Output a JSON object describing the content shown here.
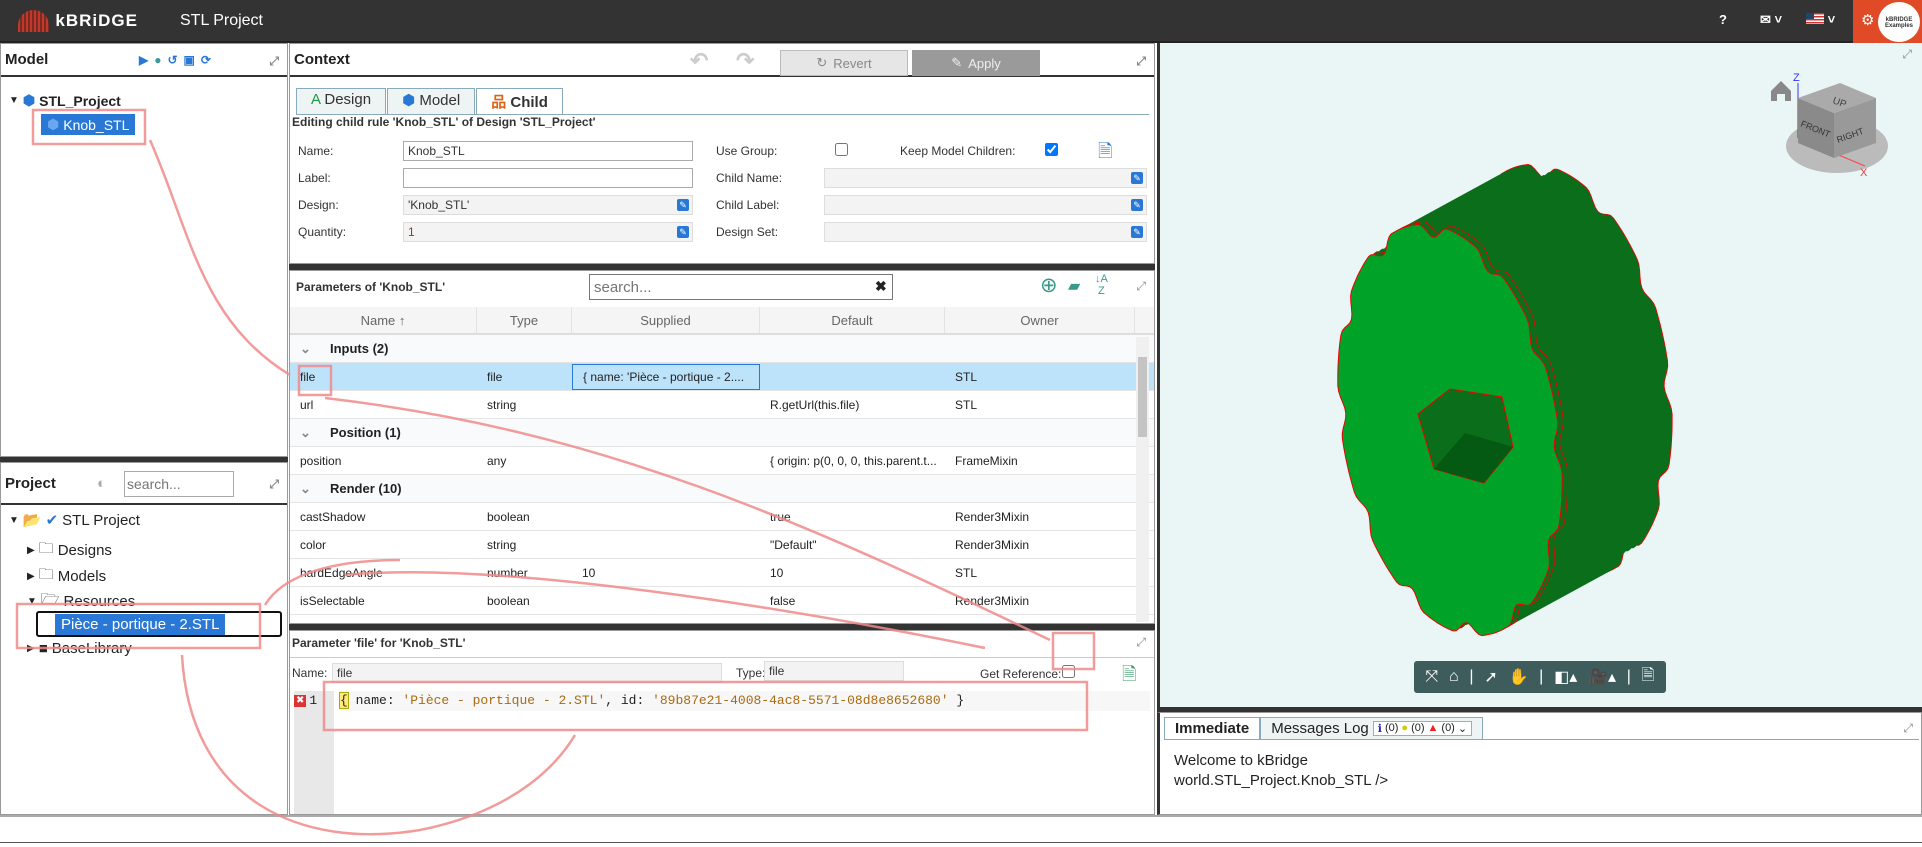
{
  "app": {
    "brand": "kBRiDGE",
    "title": "STL Project",
    "help": "?",
    "examples_logo": "kBRIDGE Examples"
  },
  "colors": {
    "accent": "#2a78d6",
    "topbar": "#333333",
    "settings": "#e04a26",
    "annotation": "#f08a8a",
    "gear_face": "#00a328",
    "gear_side": "#006a12",
    "viewer_bg": "#eaf6f6"
  },
  "model": {
    "title": "Model",
    "tree": [
      {
        "label": "STL_Project"
      },
      {
        "label": "Knob_STL",
        "selected": true
      }
    ]
  },
  "project": {
    "title": "Project",
    "search_placeholder": "search...",
    "tree": [
      {
        "label": "STL Project"
      },
      {
        "label": "Designs"
      },
      {
        "label": "Models"
      },
      {
        "label": "Resources"
      },
      {
        "label": "Pièce - portique - 2.STL",
        "selected": true
      },
      {
        "label": "BaseLibrary"
      }
    ]
  },
  "context": {
    "title": "Context",
    "revert": "Revert",
    "apply": "Apply",
    "tabs": [
      {
        "label": "Design"
      },
      {
        "label": "Model"
      },
      {
        "label": "Child",
        "active": true
      }
    ],
    "editing": "Editing child rule 'Knob_STL' of Design 'STL_Project'",
    "form": {
      "name_label": "Name:",
      "name_value": "Knob_STL",
      "label_label": "Label:",
      "label_value": "",
      "design_label": "Design:",
      "design_value": "'Knob_STL'",
      "quantity_label": "Quantity:",
      "quantity_value": "1",
      "use_group_label": "Use Group:",
      "use_group": false,
      "keep_label": "Keep Model Children:",
      "keep_model_children": true,
      "child_name_label": "Child Name:",
      "child_label_label": "Child Label:",
      "design_set_label": "Design Set:"
    }
  },
  "parameters": {
    "title": "Parameters of 'Knob_STL'",
    "search_placeholder": "search...",
    "columns": [
      "Name ↑",
      "Type",
      "Supplied",
      "Default",
      "Owner"
    ],
    "rows": [
      {
        "group": "Inputs (2)"
      },
      {
        "name": "file",
        "type": "file",
        "supplied": "{ name: 'Pièce - portique - 2....",
        "default": "",
        "owner": "STL",
        "selected": true
      },
      {
        "name": "url",
        "type": "string",
        "supplied": "",
        "default": "R.getUrl(this.file)",
        "owner": "STL"
      },
      {
        "group": "Position (1)"
      },
      {
        "name": "position",
        "type": "any",
        "supplied": "",
        "default": "{ origin: p(0, 0, 0, this.parent.t...",
        "owner": "FrameMixin"
      },
      {
        "group": "Render (10)"
      },
      {
        "name": "castShadow",
        "type": "boolean",
        "supplied": "",
        "default": "true",
        "owner": "Render3Mixin"
      },
      {
        "name": "color",
        "type": "string",
        "supplied": "",
        "default": "\"Default\"",
        "owner": "Render3Mixin"
      },
      {
        "name": "hardEdgeAngle",
        "type": "number",
        "supplied": "10",
        "default": "10",
        "owner": "STL"
      },
      {
        "name": "isSelectable",
        "type": "boolean",
        "supplied": "",
        "default": "false",
        "owner": "Render3Mixin"
      }
    ]
  },
  "param_detail": {
    "title": "Parameter 'file' for 'Knob_STL'",
    "name_label": "Name:",
    "name_value": "file",
    "type_label": "Type:",
    "type_value": "file",
    "get_ref_label": "Get Reference:",
    "get_reference": false,
    "line_no": "1",
    "code_open": "{",
    "code_key1": " name: ",
    "code_val1": "'Pièce - portique - 2.STL'",
    "code_mid": ", id: ",
    "code_val2": "'89b87e21-4008-4ac8-5571-08d8e8652680'",
    "code_close": " }"
  },
  "viewer": {
    "cube": {
      "top": "UP",
      "front": "FRONT",
      "right": "RIGHT",
      "axis_z": "Z",
      "axis_x": "X"
    }
  },
  "console": {
    "tabs": [
      {
        "label": "Immediate",
        "active": true
      },
      {
        "label": "Messages Log"
      }
    ],
    "info_count": "(0)",
    "warn_count": "(0)",
    "error_count": "(0)",
    "lines": [
      "Welcome to kBridge",
      "world.STL_Project.Knob_STL />"
    ]
  }
}
